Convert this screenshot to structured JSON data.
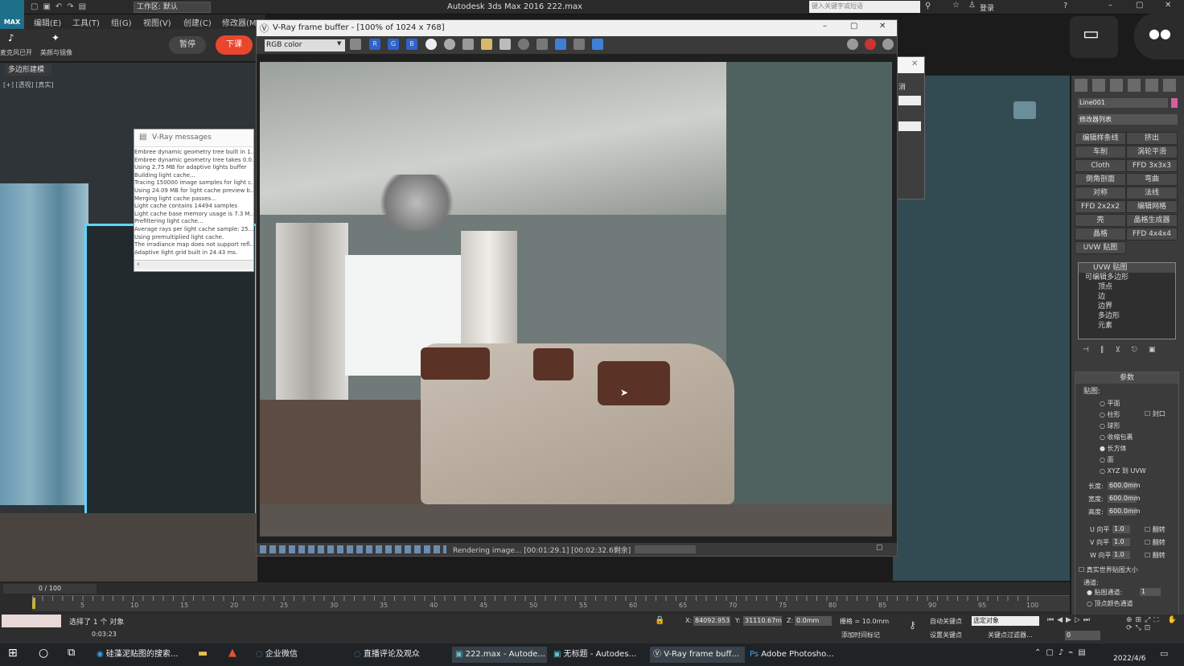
{
  "title_bar": {
    "workspace": "工作区: 默认",
    "app_title": "Autodesk 3ds Max 2016",
    "file": "222.max",
    "search_placeholder": "键入关键字或短语",
    "login": "登录",
    "logo": "MAX"
  },
  "menu": [
    "编辑(E)",
    "工具(T)",
    "组(G)",
    "视图(V)",
    "创建(C)",
    "修改器(M)"
  ],
  "toolbar2": {
    "mic": "麦克风已开",
    "beauty": "美颜与镜像",
    "pause": "暂停",
    "stop": "下课"
  },
  "ribbon_tab": "多边形建模",
  "viewport_label": "[+] [透视] [真实]",
  "vray_messages": {
    "title": "V-Ray messages",
    "lines": [
      "Embree dynamic geometry tree built in 1...",
      "Embree dynamic geometry tree takes 0.0...",
      "Using 2.75 MB for adaptive lights buffer",
      "Building light cache...",
      "Tracing 150000 image samples for light c...",
      "Using 24.09 MB for light cache preview b...",
      "Merging light cache passes...",
      "Light cache contains 14494 samples",
      "Light cache base memory usage is 7.3 M...",
      "Prefiltering light cache...",
      "Average rays per light cache sample: 25...",
      "Using premultiplied light cache.",
      "The irradiance map does not support refl...",
      "Adaptive light grid built in 24.43 ms."
    ]
  },
  "vfb": {
    "title": "V-Ray frame buffer - [100% of 1024 x 768]",
    "channel": "RGB color",
    "rgb_buttons": [
      "R",
      "G",
      "B"
    ],
    "status": "Rendering image... [00:01:29.1] [00:02:32.6剩余]"
  },
  "right_small_dialog": {
    "cancel": "消"
  },
  "command_panel": {
    "object_name": "Line001",
    "modifier_list": "修改器列表",
    "buttons": [
      [
        "编辑样条线",
        "挤出"
      ],
      [
        "车削",
        "涡轮平滑"
      ],
      [
        "Cloth",
        "FFD 3x3x3"
      ],
      [
        "倒角剖面",
        "弯曲"
      ],
      [
        "对称",
        "法线"
      ],
      [
        "FFD 2x2x2",
        "编辑网格"
      ],
      [
        "壳",
        "晶格生成器"
      ],
      [
        "晶格",
        "FFD 4x4x4"
      ],
      [
        "UVW 贴图",
        ""
      ]
    ],
    "stack": [
      "UVW 贴图",
      "可编辑多边形",
      "顶点",
      "边",
      "边界",
      "多边形",
      "元素"
    ],
    "params_title": "参数",
    "mapping_title": "贴图:",
    "mapping_types": [
      "平面",
      "柱形",
      "球形",
      "收缩包裹",
      "长方体",
      "面",
      "XYZ 到 UVW"
    ],
    "mapping_selected": "长方体",
    "cap": "封口",
    "length_label": "长度:",
    "length": "600.0mm",
    "width_label": "宽度:",
    "width": "600.0mm",
    "height_label": "高度:",
    "height": "600.0mm",
    "u_tile_label": "U 向平",
    "u_tile": "1.0",
    "v_tile_label": "V 向平",
    "v_tile": "1.0",
    "w_tile_label": "W 向平",
    "w_tile": "1.0",
    "flip": "翻转",
    "real_world": "真实世界贴图大小",
    "channel_title": "通道:",
    "map_channel": "贴图通道:",
    "map_channel_value": "1",
    "vertex_channel": "顶点颜色通道"
  },
  "timeline": {
    "frame": "0 / 100",
    "ticks": [
      "0",
      "5",
      "10",
      "15",
      "20",
      "25",
      "30",
      "35",
      "40",
      "45",
      "50",
      "55",
      "60",
      "65",
      "70",
      "75",
      "80",
      "85",
      "90",
      "95",
      "100"
    ]
  },
  "status": {
    "selected": "选择了 1 个 对象",
    "time": "0:03:23",
    "x_label": "X:",
    "x": "84092.953",
    "y_label": "Y:",
    "y": "31110.67m",
    "z_label": "Z:",
    "z": "0.0mm",
    "grid": "栅格 = 10.0mm",
    "autokey": "自动关键点",
    "set_key": "设置关键点",
    "selected_obj": "选定对象",
    "key_filter": "关键点过滤器...",
    "add_time_tag": "添加时间标记",
    "frame_field": "0"
  },
  "taskbar": {
    "items": [
      "硅藻泥贴图的搜索...",
      "企业微信",
      "直播评论及观众",
      "222.max - Autode...",
      "无标题 - Autodes...",
      "V-Ray frame buff...",
      "Adobe Photosho..."
    ],
    "date": "2022/4/6"
  },
  "colors": {
    "accent": "#3fa9f5",
    "stop_button": "#e8472e",
    "vp_teal": "#324a52"
  }
}
